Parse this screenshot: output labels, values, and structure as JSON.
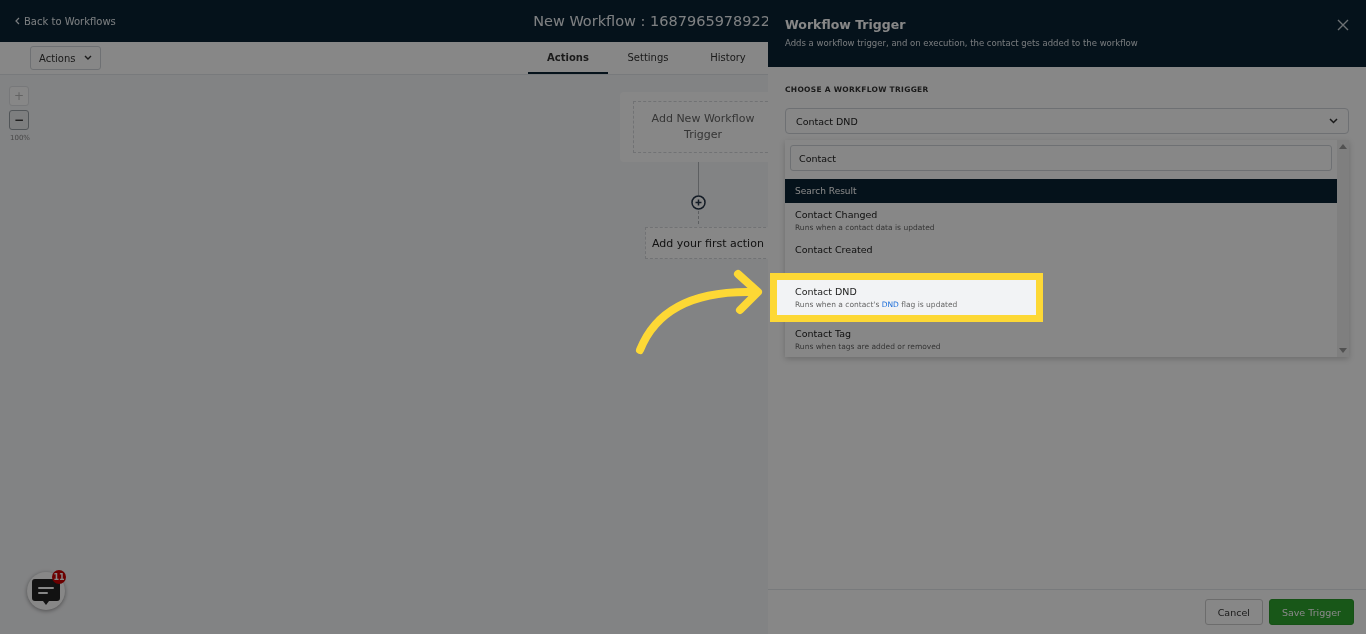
{
  "header": {
    "back_link": "Back to Workflows",
    "title": "New Workflow : 1687965978922"
  },
  "toolbar": {
    "actions_menu": "Actions",
    "tabs": [
      {
        "label": "Actions",
        "selected": true
      },
      {
        "label": "Settings",
        "selected": false
      },
      {
        "label": "History",
        "selected": false
      }
    ]
  },
  "zoom": {
    "zoom_in": "+",
    "zoom_out": "−",
    "level_text": "100%"
  },
  "canvas": {
    "trigger_node": "Add New Workflow Trigger",
    "first_action": "Add your first action"
  },
  "chat": {
    "badge": "11"
  },
  "drawer": {
    "title": "Workflow Trigger",
    "subtitle": "Adds a workflow trigger, and on execution, the contact gets added to the workflow",
    "section_label": "CHOOSE A WORKFLOW TRIGGER",
    "selected_value": "Contact DND",
    "search": {
      "value": "Contact"
    },
    "group_header": "Search Result",
    "options": [
      {
        "title": "Contact Changed",
        "description": "Runs when a contact data is updated",
        "selected": false
      },
      {
        "title": "Contact Created",
        "selected": false
      },
      {
        "title": "Contact DND",
        "description": "Runs when a contact's **DND** flag is updated",
        "selected": true
      },
      {
        "title": "Contact Tag",
        "description": "Runs when tags are added or removed",
        "selected": false
      }
    ],
    "cancel": "Cancel",
    "save": "Save Trigger"
  }
}
